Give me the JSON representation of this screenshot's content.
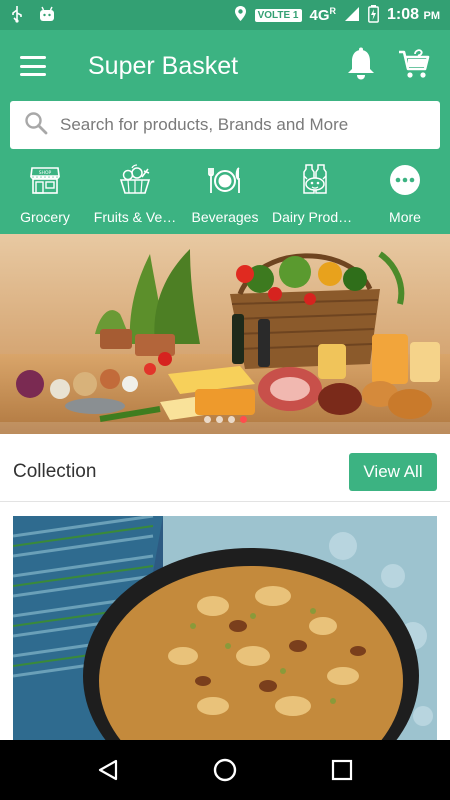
{
  "status_bar": {
    "network_badge": "VOLTE 1",
    "network_type": "4G",
    "network_super": "R",
    "time": "1:08",
    "time_suffix": "PM"
  },
  "app_bar": {
    "title": "Super Basket",
    "icons": [
      "menu-icon",
      "bell-icon",
      "cart-icon"
    ]
  },
  "search": {
    "placeholder": "Search for products, Brands and More"
  },
  "categories": [
    {
      "label": "Grocery",
      "icon": "store-icon"
    },
    {
      "label": "Fruits & Ve…",
      "icon": "fruits-basket-icon"
    },
    {
      "label": "Beverages",
      "icon": "dining-icon"
    },
    {
      "label": "Dairy Produ…",
      "icon": "dairy-icon"
    },
    {
      "label": "More",
      "icon": "more-icon"
    }
  ],
  "banner": {
    "slide_count": 4,
    "active_slide": 4
  },
  "collection": {
    "title": "Collection",
    "view_all_label": "View All"
  },
  "colors": {
    "primary": "#3cb382",
    "status_bar": "#33a073",
    "accent_dot": "#ff4d4d"
  }
}
